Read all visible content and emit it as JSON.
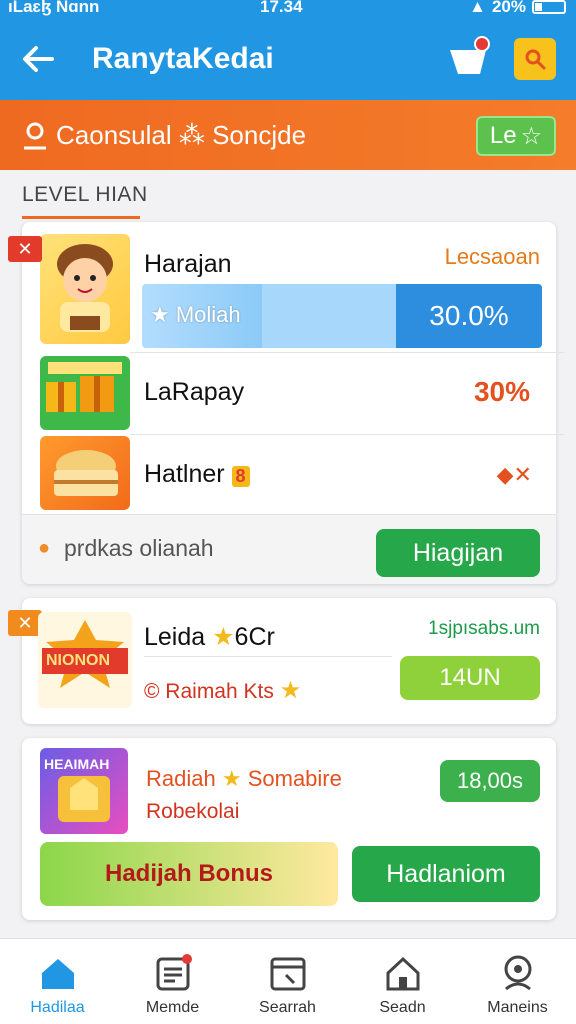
{
  "status_bar": {
    "carrier": "ıLaɛɮ Nɑnn",
    "time": "17.34",
    "battery": "20%"
  },
  "app_bar": {
    "title": "RanytaKedai"
  },
  "banner": {
    "text": "Caonsulal ⁂ Soncjde",
    "button": "Le"
  },
  "section": {
    "title": "LEVEL HIAN"
  },
  "card1": {
    "items": [
      {
        "name": "Harajan",
        "right_text": "Lecsaoan"
      },
      {
        "name": "LaRapay",
        "percent": "30%"
      },
      {
        "name": "Hatlner",
        "badge": "8"
      }
    ],
    "progress": {
      "label": "Moliah",
      "value_text": "30.0%",
      "fraction": 0.3
    },
    "footer": {
      "text": "prdkas olianah",
      "button": "Hiagijan"
    }
  },
  "card2": {
    "thumb_text": "NIONON",
    "title": "Leida",
    "title_suffix": "6Cr",
    "subtitle": "© Raimah Kts",
    "right_text": "1sjpısabs.um",
    "button": "14UN"
  },
  "card3": {
    "thumb_text": "HEAIMAH",
    "title": "Radiah",
    "title_suffix": "Somabire",
    "subtitle": "Robekolai",
    "price_button": "18,00s",
    "bonus_button": "Hadijah Bonus",
    "action_button": "Hadlaniom"
  },
  "bottom_nav": [
    {
      "label": "Hadilaa",
      "icon": "home-icon",
      "active": true
    },
    {
      "label": "Memde",
      "icon": "list-icon",
      "active": false
    },
    {
      "label": "Searrah",
      "icon": "image-icon",
      "active": false
    },
    {
      "label": "Seadn",
      "icon": "house-icon",
      "active": false
    },
    {
      "label": "Maneins",
      "icon": "profile-icon",
      "active": false
    }
  ],
  "colors": {
    "primary": "#2196e3",
    "accent": "#ef6a21",
    "green": "#26a84a",
    "lime": "#8ed13a"
  }
}
